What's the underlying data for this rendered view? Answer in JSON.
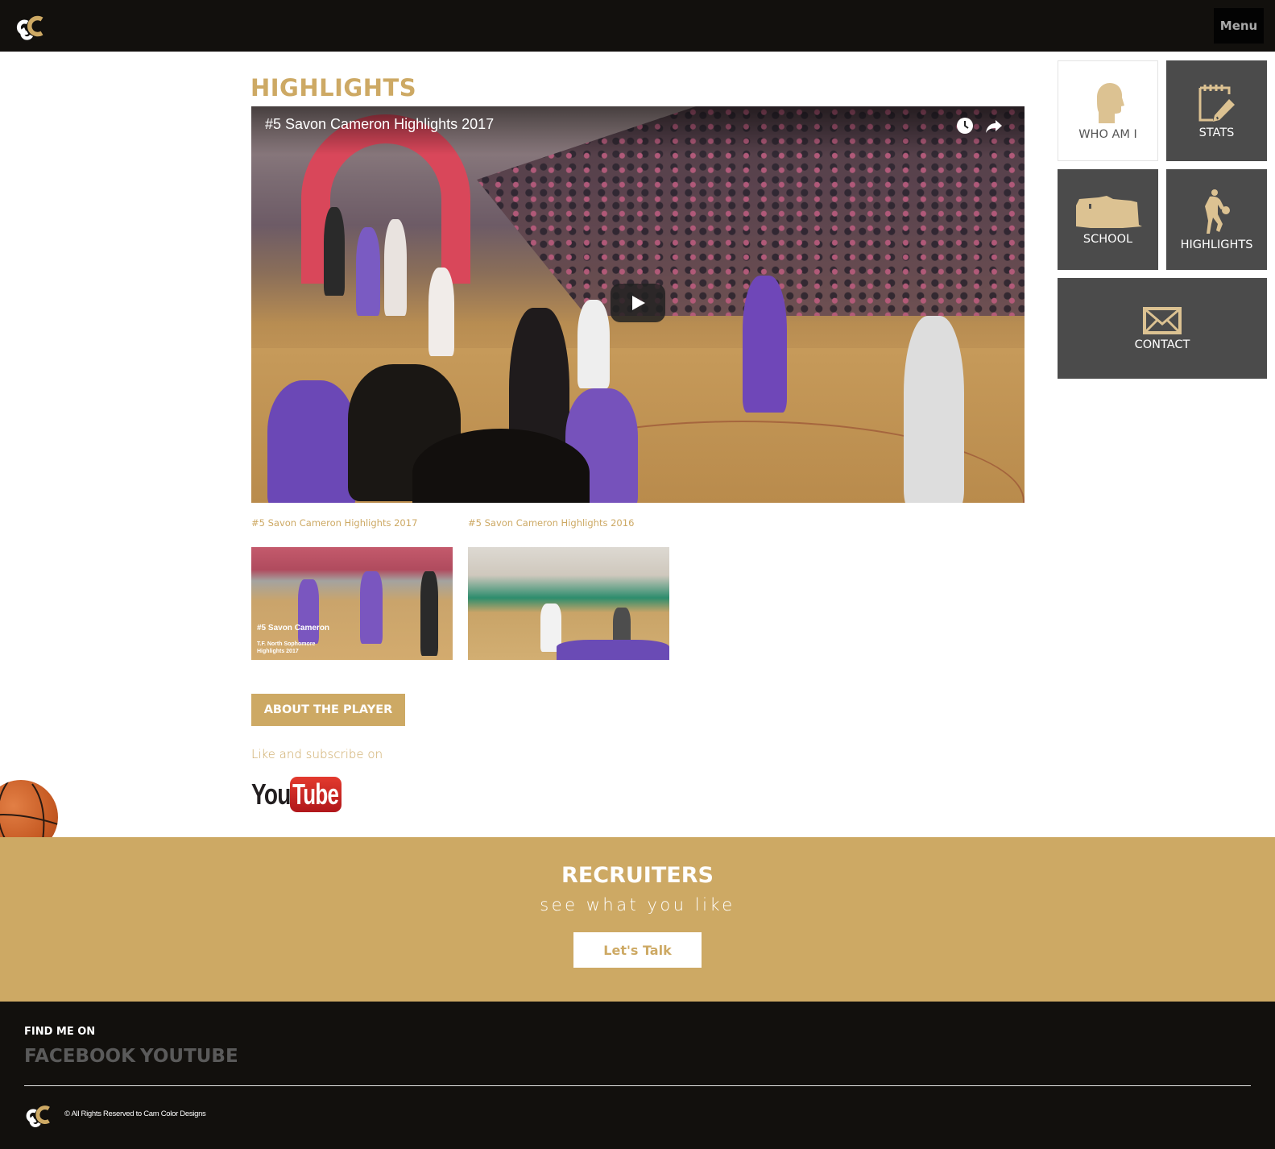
{
  "header": {
    "logo_alt": "CC logo",
    "menu_label": "Menu"
  },
  "main": {
    "title": "HIGHLIGHTS",
    "video": {
      "title": "#5 Savon Cameron Highlights 2017",
      "icons": [
        "watch-later-icon",
        "share-icon",
        "play-icon"
      ]
    },
    "related": [
      {
        "label": "#5 Savon Cameron Highlights 2017",
        "overlay_title": "#5 Savon Cameron",
        "overlay_subtitle": "T.F. North Sophomore Highlights 2017"
      },
      {
        "label": "#5 Savon Cameron Highlights 2016"
      }
    ],
    "about_button": "ABOUT THE PLAYER",
    "subscribe_text": "Like and subscribe on",
    "youtube_logo": {
      "you": "You",
      "tube": "Tube"
    }
  },
  "tiles": [
    {
      "label": "WHO AM I",
      "icon": "head-silhouette-icon"
    },
    {
      "label": "STATS",
      "icon": "notepad-pencil-icon"
    },
    {
      "label": "SCHOOL",
      "icon": "school-building-icon"
    },
    {
      "label": "HIGHLIGHTS",
      "icon": "basketball-player-icon"
    },
    {
      "label": "CONTACT",
      "icon": "envelope-icon"
    }
  ],
  "recruiters": {
    "title": "RECRUITERS",
    "subtitle": "see what you like",
    "button": "Let's Talk"
  },
  "footer": {
    "find_me_label": "FIND ME ON",
    "links": [
      "FACEBOOK",
      "YOUTUBE"
    ],
    "copyright": "© All Rights Reserved to Cam Color Designs"
  },
  "colors": {
    "gold": "#cda964",
    "tile_gold": "#dcc292",
    "dark": "#12100d",
    "tile_dark": "#4b4b4b",
    "footer_link": "#5a5a5a"
  }
}
